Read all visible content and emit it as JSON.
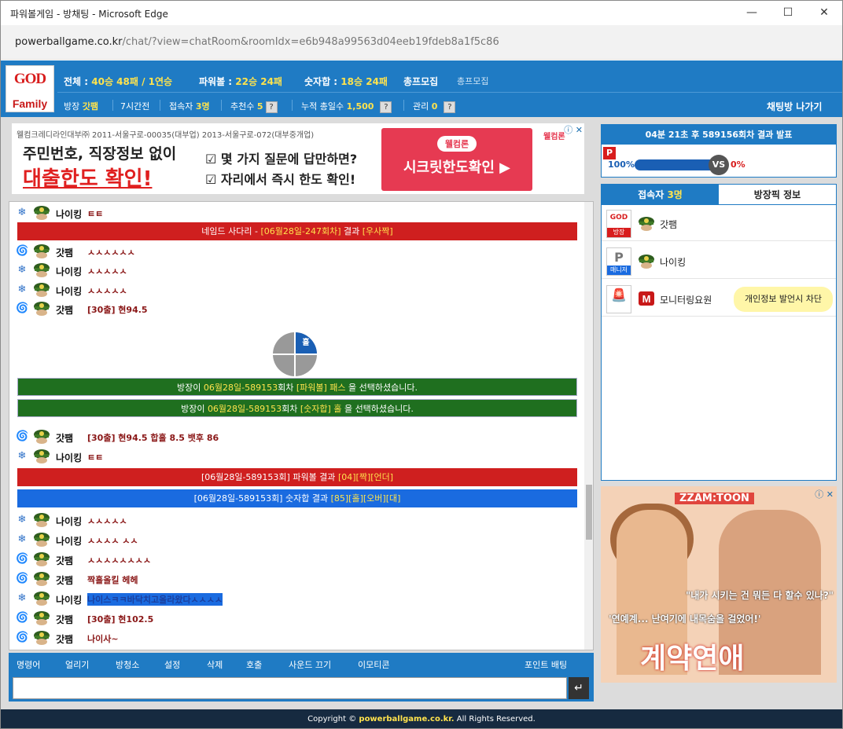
{
  "window": {
    "title": "파워볼게임 - 방채팅 - Microsoft Edge",
    "url_host": "powerballgame.co.kr",
    "url_path": "/chat/?view=chatRoom&roomIdx=e6b948a99563d04eeb19fdeb8a1f5c86",
    "minimize": "—",
    "maximize": "☐",
    "close": "✕"
  },
  "logo": {
    "line1": "GOD",
    "line2": "Family"
  },
  "stats": {
    "total_label": "전체 :",
    "total_value": "40승 48패 / 1연승",
    "powerball_label": "파워볼 :",
    "powerball_value": "22승 24패",
    "sum_label": "숫자합 :",
    "sum_value": "18승 24패",
    "recruit": "총프모집",
    "recruit_small": "총프모집"
  },
  "room": {
    "owner_label": "방장",
    "owner_value": "갓팸",
    "hours": "7시간전",
    "users_label": "접속자",
    "users_value": "3명",
    "recommend_label": "추천수",
    "recommend_value": "5",
    "cum_label": "누적 총일수",
    "cum_value": "1,500",
    "admin_label": "관리",
    "admin_value": "0",
    "q": "?",
    "exit": "채팅방 나가기"
  },
  "ad_top": {
    "line": "웰컴크레디라인대부㈜ 2011-서울구로-00035(대부업) 2013-서울구로-072(대부중개업)",
    "big1": "주민번호, 직장정보 없이",
    "big2": "대출한도 확인!",
    "check1": "☑ 몇 가지 질문에 답만하면?",
    "check2": "☑ 자리에서 즉시 한도 확인!",
    "btn_small": "웰컴론",
    "btn_big": "시크릿한도확인 ▶",
    "brand": "웰컴론",
    "close": "ⓘ ✕"
  },
  "chat": {
    "messages": [
      {
        "type": "user",
        "icon": "blue",
        "name": "나이킹",
        "text": "ㅌㅌ"
      },
      {
        "type": "bar",
        "color": "red",
        "pre": "네임드 사다리 - ",
        "hl": "[06월28일-247회차]",
        "post": " 결과 ",
        "hl2": "[우사짝]"
      },
      {
        "type": "user",
        "icon": "red",
        "name": "갓팸",
        "text": "ㅅㅅㅅㅅㅅㅅ"
      },
      {
        "type": "user",
        "icon": "blue",
        "name": "나이킹",
        "text": "ㅅㅅㅅㅅㅅ"
      },
      {
        "type": "user",
        "icon": "blue",
        "name": "나이킹",
        "text": "ㅅㅅㅅㅅㅅ"
      },
      {
        "type": "user",
        "icon": "red",
        "name": "갓팸",
        "text": "[30출] 현94.5"
      },
      {
        "type": "bar",
        "color": "green",
        "pre": "방장이 ",
        "hl": "06월28일-589153",
        "post": "회차 ",
        "hl2": "[파워볼] 패스",
        "tail": " 을 선택하셨습니다."
      },
      {
        "type": "bar",
        "color": "green",
        "pre": "방장이 ",
        "hl": "06월28일-589153",
        "post": "회차 ",
        "hl2": "[숫자합] 홀",
        "tail": " 을 선택하셨습니다."
      },
      {
        "type": "user",
        "icon": "red",
        "name": "갓팸",
        "text": "[30출] 현94.5  합홀 8.5 뱃후 86"
      },
      {
        "type": "user",
        "icon": "blue",
        "name": "나이킹",
        "text": "ㅌㅌ"
      },
      {
        "type": "bar",
        "color": "red",
        "pre": "[06월28일-589153회] 파워볼 결과 ",
        "hl": "[04]",
        "post": "",
        "hl2": "[짝][언더]"
      },
      {
        "type": "bar",
        "color": "blue",
        "pre": "[06월28일-589153회] 숫자합 결과 ",
        "hl": "[85]",
        "post": "",
        "hl2": "[홀][오버][대]"
      },
      {
        "type": "user",
        "icon": "blue",
        "name": "나이킹",
        "text": "ㅅㅅㅅㅅㅅ"
      },
      {
        "type": "user",
        "icon": "blue",
        "name": "나이킹",
        "text": "ㅅㅅㅅㅅ ㅅㅅ"
      },
      {
        "type": "user",
        "icon": "red",
        "name": "갓팸",
        "text": "ㅅㅅㅅㅅㅅㅅㅅㅅ"
      },
      {
        "type": "user",
        "icon": "red",
        "name": "갓팸",
        "text": "짝홀올킬 헤헤"
      },
      {
        "type": "user",
        "icon": "blue",
        "name": "나이킹",
        "text": "나이스ㅋㅋ바닥치고올라왔다ㅅㅅㅅㅅ",
        "blue": true
      },
      {
        "type": "user",
        "icon": "red",
        "name": "갓팸",
        "text": "[30출] 현102.5"
      },
      {
        "type": "user",
        "icon": "red",
        "name": "갓팸",
        "text": "나이사~"
      }
    ],
    "pie_label": "홀"
  },
  "chat_menu": [
    "명령어",
    "얼리기",
    "방청소",
    "설정",
    "삭제",
    "호출",
    "사운드 끄기",
    "이모티콘"
  ],
  "point_bet": "포인트 배팅",
  "send_icon": "↵",
  "result": {
    "header": "04분 21초 후 589156회차 결과 발표",
    "p": "P",
    "left_pct": "100%",
    "right_pct": "0%",
    "vs": "VS",
    "fill": 1.0
  },
  "users_panel": {
    "tab1_label": "접속자",
    "tab1_count": "3명",
    "tab2": "방장픽 정보",
    "users": [
      {
        "badge_top": "GOD",
        "badge_role": "방장",
        "name": "갓팸"
      },
      {
        "badge_top": "P",
        "badge_role": "매니저",
        "name": "나이킹"
      },
      {
        "badge_top": "🚨",
        "badge_role": "",
        "name": "모니터링요원",
        "tip": "개인정보 발언시 차단"
      }
    ]
  },
  "ad_right": {
    "brand": "ZZAM:TOON",
    "line1": "\"내가 시키는 건 뭐든 다 할수 있나?\"",
    "line2": "'연예계... 난여기에 내목숨을 걸었어!'",
    "big": "계약연애",
    "close": "ⓘ ✕"
  },
  "footer": {
    "pre": "Copyright ©",
    "site": "powerballgame.co.kr.",
    "post": "All Rights Reserved."
  },
  "colors": {
    "accent": "#1f7bc4",
    "red": "#cf1f1f",
    "green": "#1f6f1f",
    "yellow": "#ffe34d",
    "footer": "#162a40"
  }
}
